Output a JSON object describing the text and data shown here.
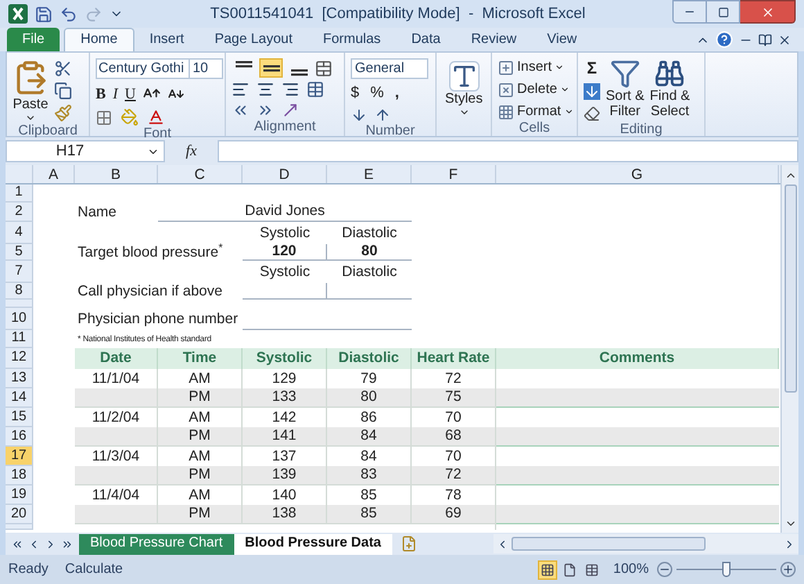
{
  "window": {
    "title": "TS0011541041  [Compatibility Mode]  -  Microsoft Excel"
  },
  "ribbon_tabs": [
    {
      "label": "File",
      "kind": "file",
      "selected": false
    },
    {
      "label": "Home",
      "kind": "tab",
      "selected": true
    },
    {
      "label": "Insert",
      "kind": "tab",
      "selected": false
    },
    {
      "label": "Page Layout",
      "kind": "tab",
      "selected": false
    },
    {
      "label": "Formulas",
      "kind": "tab",
      "selected": false
    },
    {
      "label": "Data",
      "kind": "tab",
      "selected": false
    },
    {
      "label": "Review",
      "kind": "tab",
      "selected": false
    },
    {
      "label": "View",
      "kind": "tab",
      "selected": false
    }
  ],
  "ribbon_groups": [
    {
      "kind": "clipboard",
      "label": "Clipboard",
      "paste": "Paste"
    },
    {
      "kind": "font",
      "label": "Font",
      "font_name": "Century Gothi",
      "font_size": "10",
      "bold": "B",
      "italic": "I",
      "underline": "U"
    },
    {
      "kind": "alignment",
      "label": "Alignment",
      "vertical_align": [
        {
          "selected": false
        },
        {
          "selected": true
        },
        {
          "selected": false
        }
      ]
    },
    {
      "kind": "number",
      "label": "Number",
      "format": "General",
      "currency": "$",
      "percent": "%",
      "comma": ","
    },
    {
      "kind": "styles",
      "button": "Styles"
    },
    {
      "kind": "cells",
      "label": "Cells",
      "buttons": [
        "Insert",
        "Delete",
        "Format"
      ]
    },
    {
      "kind": "editing",
      "label": "Editing",
      "sum": "Σ",
      "sort": [
        "Sort &",
        "Filter"
      ],
      "find": [
        "Find &",
        "Select"
      ]
    }
  ],
  "formula_bar": {
    "name_box": "H17",
    "fx": "fx"
  },
  "columns": [
    "A",
    "B",
    "C",
    "D",
    "E",
    "F",
    "G"
  ],
  "rows": [
    {
      "number": "1",
      "selected": false,
      "kind": "blank"
    },
    {
      "number": "2",
      "selected": false,
      "kind": "name",
      "label": "Name",
      "value": "David Jones"
    },
    {
      "number": "4",
      "selected": false,
      "kind": "subhead",
      "values": [
        "Systolic",
        "Diastolic"
      ]
    },
    {
      "number": "5",
      "selected": false,
      "kind": "target",
      "label": "Target blood pressure$^{*}$",
      "values": [
        "120",
        "80"
      ]
    },
    {
      "number": "7",
      "selected": false,
      "kind": "subhead",
      "values": [
        "Systolic",
        "Diastolic"
      ]
    },
    {
      "number": "8",
      "selected": false,
      "kind": "call",
      "label": "Call physician if above"
    },
    {
      "kind": "spacer"
    },
    {
      "number": "10",
      "selected": false,
      "kind": "phone",
      "label": "Physician phone number"
    },
    {
      "number": "11",
      "selected": false,
      "kind": "note",
      "text": "* National Institutes of Health standard"
    },
    {
      "number": "12",
      "selected": false,
      "kind": "header",
      "cells": [
        "Date",
        "Time",
        "Systolic",
        "Diastolic",
        "Heart Rate",
        "Comments"
      ]
    },
    {
      "number": "13",
      "selected": false,
      "kind": "data",
      "date": "11/1/04",
      "cells": [
        "AM",
        "129",
        "79",
        "72"
      ]
    },
    {
      "number": "14",
      "selected": false,
      "kind": "data",
      "cells": [
        "PM",
        "133",
        "80",
        "75"
      ]
    },
    {
      "number": "15",
      "selected": false,
      "kind": "data",
      "date": "11/2/04",
      "cells": [
        "AM",
        "142",
        "86",
        "70"
      ]
    },
    {
      "number": "16",
      "selected": false,
      "kind": "data",
      "cells": [
        "PM",
        "141",
        "84",
        "68"
      ]
    },
    {
      "number": "17",
      "selected": true,
      "kind": "data",
      "date": "11/3/04",
      "cells": [
        "AM",
        "137",
        "84",
        "70"
      ]
    },
    {
      "number": "18",
      "selected": false,
      "kind": "data",
      "cells": [
        "PM",
        "139",
        "83",
        "72"
      ]
    },
    {
      "number": "19",
      "selected": false,
      "kind": "data",
      "date": "11/4/04",
      "cells": [
        "AM",
        "140",
        "85",
        "78"
      ]
    },
    {
      "number": "20",
      "selected": false,
      "kind": "data",
      "cells": [
        "PM",
        "138",
        "85",
        "69"
      ]
    },
    {
      "kind": "partial"
    }
  ],
  "sheet_tabs": [
    {
      "label": "Blood Pressure Chart",
      "selected": false
    },
    {
      "label": "Blood Pressure Data",
      "selected": true
    }
  ],
  "status_bar": {
    "texts": [
      "Ready",
      "Calculate"
    ],
    "views": [
      {
        "selected": true
      },
      {
        "selected": false
      },
      {
        "selected": false
      }
    ],
    "zoom": "100%",
    "zoom_slider": {
      "level": 0.5
    }
  }
}
